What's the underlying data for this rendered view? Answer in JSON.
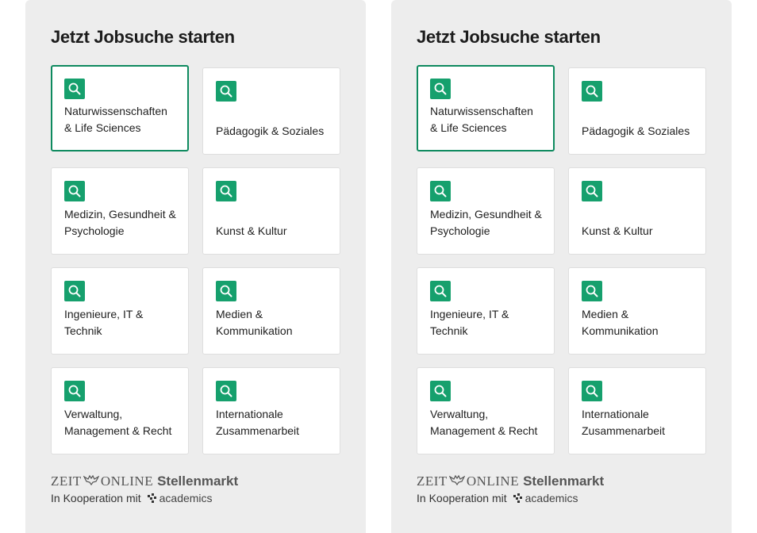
{
  "widgets": [
    {
      "title": "Jetzt Jobsuche starten",
      "tiles": [
        {
          "label_lines": [
            "Naturwissenschaften",
            "& Life Sciences"
          ],
          "active": true
        },
        {
          "label_lines": [
            "Pädagogik & Soziales"
          ],
          "active": false
        },
        {
          "label_lines": [
            "Medizin, Gesundheit &",
            "Psychologie"
          ],
          "active": false
        },
        {
          "label_lines": [
            "Kunst & Kultur"
          ],
          "active": false
        },
        {
          "label_lines": [
            "Ingenieure, IT &",
            "Technik"
          ],
          "active": false
        },
        {
          "label_lines": [
            "Medien &",
            "Kommunikation"
          ],
          "active": false
        },
        {
          "label_lines": [
            "Verwaltung,",
            "Management & Recht"
          ],
          "active": false
        },
        {
          "label_lines": [
            "Internationale",
            "Zusammenarbeit"
          ],
          "active": false
        }
      ],
      "brand": {
        "zeit": "ZEIT",
        "online": "ONLINE",
        "stellenmarkt": "Stellenmarkt",
        "cooperation": "In Kooperation mit",
        "partner": "academics"
      }
    },
    {
      "title": "Jetzt Jobsuche starten",
      "tiles": [
        {
          "label_lines": [
            "Naturwissenschaften",
            "& Life Sciences"
          ],
          "active": true
        },
        {
          "label_lines": [
            "Pädagogik & Soziales"
          ],
          "active": false
        },
        {
          "label_lines": [
            "Medizin, Gesundheit &",
            "Psychologie"
          ],
          "active": false
        },
        {
          "label_lines": [
            "Kunst & Kultur"
          ],
          "active": false
        },
        {
          "label_lines": [
            "Ingenieure, IT &",
            "Technik"
          ],
          "active": false
        },
        {
          "label_lines": [
            "Medien &",
            "Kommunikation"
          ],
          "active": false
        },
        {
          "label_lines": [
            "Verwaltung,",
            "Management & Recht"
          ],
          "active": false
        },
        {
          "label_lines": [
            "Internationale",
            "Zusammenarbeit"
          ],
          "active": false
        }
      ],
      "brand": {
        "zeit": "ZEIT",
        "online": "ONLINE",
        "stellenmarkt": "Stellenmarkt",
        "cooperation": "In Kooperation mit",
        "partner": "academics"
      }
    }
  ],
  "colors": {
    "panel_bg": "#ededed",
    "accent_green": "#16a06d",
    "active_border": "#0e8a5f"
  },
  "icons": {
    "tile_icon": "search-icon"
  }
}
